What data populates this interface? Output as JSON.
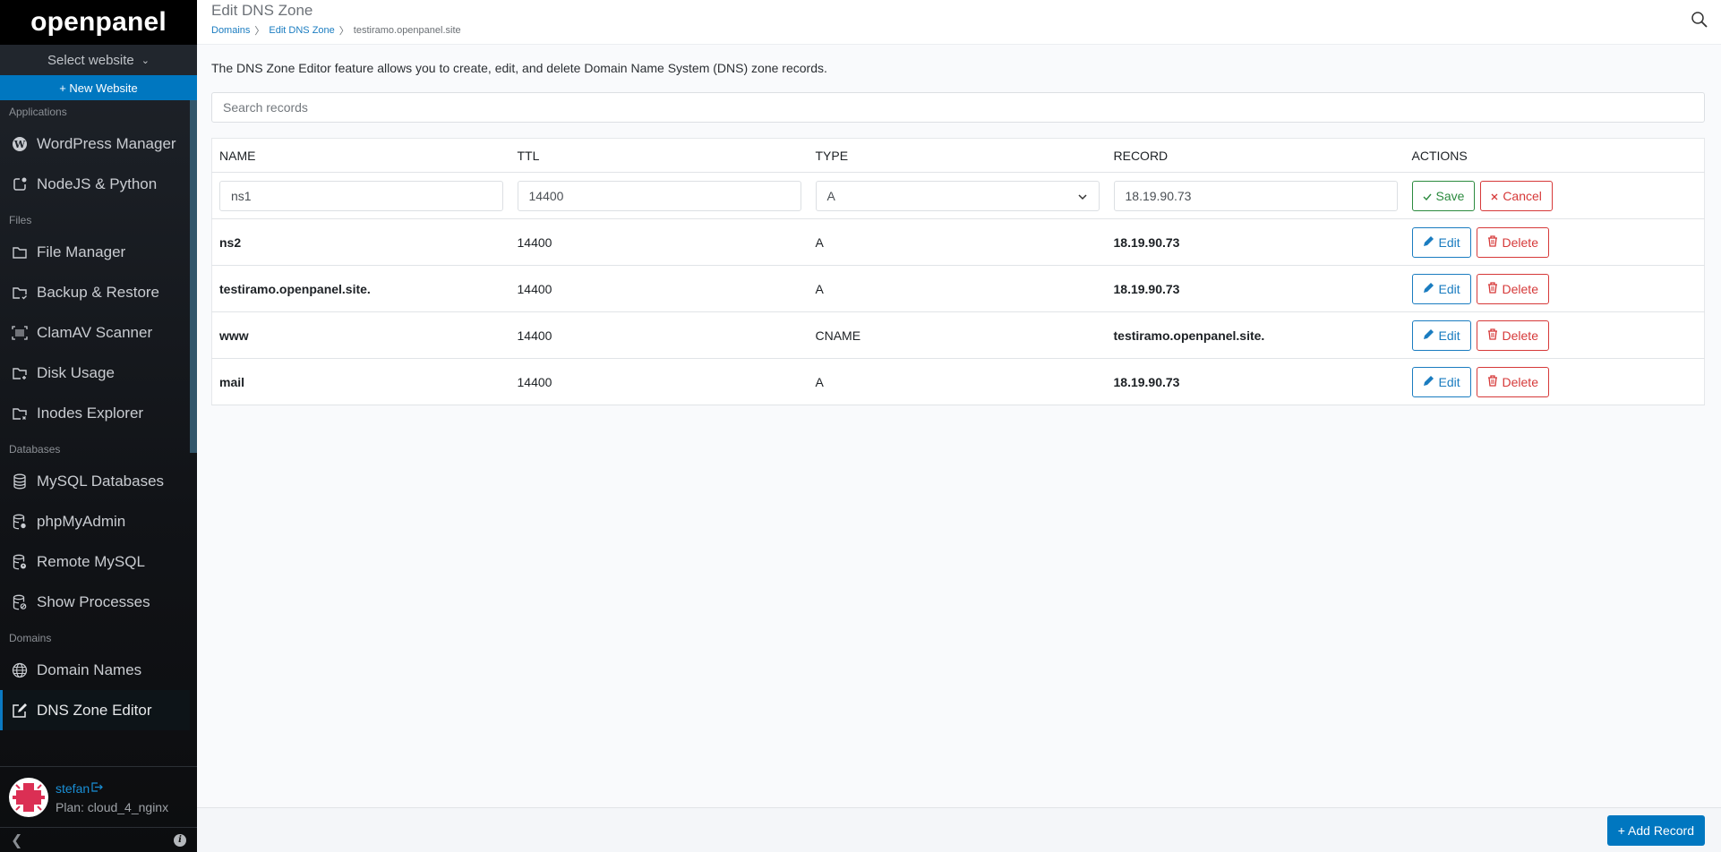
{
  "sidebar": {
    "logo": "openpanel",
    "select_website": "Select website",
    "new_website": "+ New Website",
    "sections": [
      {
        "label": "Applications",
        "items": [
          {
            "label": "WordPress Manager",
            "icon": "wordpress-icon"
          },
          {
            "label": "NodeJS & Python",
            "icon": "app-notification-icon"
          }
        ]
      },
      {
        "label": "Files",
        "items": [
          {
            "label": "File Manager",
            "icon": "folder-icon"
          },
          {
            "label": "Backup & Restore",
            "icon": "folder-check-icon"
          },
          {
            "label": "ClamAV Scanner",
            "icon": "barcode-scan-icon"
          },
          {
            "label": "Disk Usage",
            "icon": "folder-plus-icon"
          },
          {
            "label": "Inodes Explorer",
            "icon": "folder-x-icon"
          }
        ]
      },
      {
        "label": "Databases",
        "items": [
          {
            "label": "MySQL Databases",
            "icon": "database-icon"
          },
          {
            "label": "phpMyAdmin",
            "icon": "database-cog-icon"
          },
          {
            "label": "Remote MySQL",
            "icon": "database-exclamation-icon"
          },
          {
            "label": "Show Processes",
            "icon": "database-off-icon"
          }
        ]
      },
      {
        "label": "Domains",
        "items": [
          {
            "label": "Domain Names",
            "icon": "globe-icon"
          },
          {
            "label": "DNS Zone Editor",
            "icon": "edit-icon",
            "active": true
          }
        ]
      }
    ],
    "user": {
      "name": "stefan",
      "plan": "Plan: cloud_4_nginx"
    }
  },
  "header": {
    "title": "Edit DNS Zone",
    "breadcrumb": [
      "Domains",
      "Edit DNS Zone",
      "testiramo.openpanel.site"
    ]
  },
  "main": {
    "description": "The DNS Zone Editor feature allows you to create, edit, and delete Domain Name System (DNS) zone records.",
    "search_placeholder": "Search records",
    "columns": [
      "NAME",
      "TTL",
      "TYPE",
      "RECORD",
      "ACTIONS"
    ],
    "editing_row": {
      "name": "ns1",
      "ttl": "14400",
      "type": "A",
      "record": "18.19.90.73",
      "save_label": "Save",
      "cancel_label": "Cancel"
    },
    "rows": [
      {
        "name": "ns2",
        "ttl": "14400",
        "type": "A",
        "record": "18.19.90.73"
      },
      {
        "name": "testiramo.openpanel.site.",
        "ttl": "14400",
        "type": "A",
        "record": "18.19.90.73"
      },
      {
        "name": "www",
        "ttl": "14400",
        "type": "CNAME",
        "record": "testiramo.openpanel.site."
      },
      {
        "name": "mail",
        "ttl": "14400",
        "type": "A",
        "record": "18.19.90.73"
      }
    ],
    "edit_label": "Edit",
    "delete_label": "Delete",
    "add_record_label": "+ Add Record"
  },
  "colors": {
    "accent": "#0077c0",
    "success": "#2b8a3e",
    "danger": "#d63939"
  }
}
